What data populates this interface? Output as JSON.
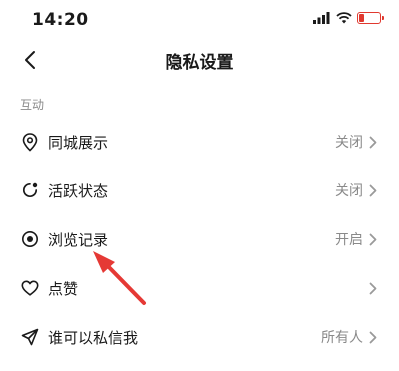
{
  "status_bar": {
    "time": "14:20"
  },
  "nav": {
    "title": "隐私设置"
  },
  "section": {
    "label": "互动"
  },
  "rows": [
    {
      "label": "同城展示",
      "value": "关闭"
    },
    {
      "label": "活跃状态",
      "value": "关闭"
    },
    {
      "label": "浏览记录",
      "value": "开启"
    },
    {
      "label": "点赞",
      "value": ""
    },
    {
      "label": "谁可以私信我",
      "value": "所有人"
    }
  ],
  "colors": {
    "annotation_arrow": "#e53935",
    "battery": "#e0392f",
    "muted_text": "#8a8a8a"
  },
  "icons": [
    "location-pin-icon",
    "activity-status-icon",
    "eye-icon",
    "heart-icon",
    "send-icon",
    "chevron-right-icon",
    "back-arrow-icon"
  ]
}
